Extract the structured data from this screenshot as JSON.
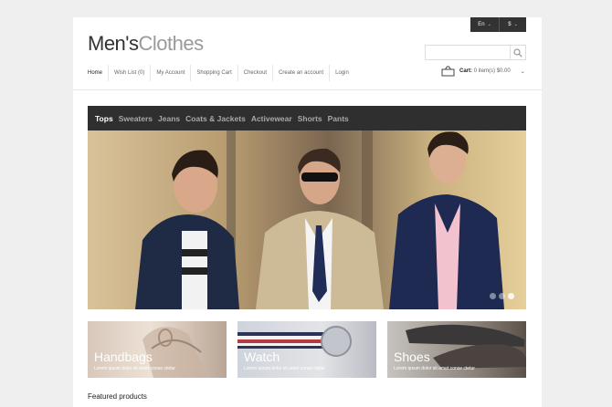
{
  "topbar": {
    "language": "En",
    "currency": "$"
  },
  "logo": {
    "part1": "Men's",
    "part2": "Clothes"
  },
  "search": {
    "placeholder": ""
  },
  "nav": [
    "Home",
    "Wish List (0)",
    "My Account",
    "Shopping Cart",
    "Checkout",
    "Create an account",
    "Login"
  ],
  "cart": {
    "label": "Cart:",
    "summary": "0 item(s) $0.00"
  },
  "categories": [
    "Tops",
    "Sweaters",
    "Jeans",
    "Coats & Jackets",
    "Activewear",
    "Shorts",
    "Pants"
  ],
  "slider": {
    "total_slides": 3,
    "active_slide": 3
  },
  "banners": [
    {
      "title": "Handbags",
      "text": "Lorem ipsum dolor sit amet conse ctetur"
    },
    {
      "title": "Watch",
      "text": "Lorem ipsum dolor sit amet conse ctetur"
    },
    {
      "title": "Shoes",
      "text": "Lorem ipsum dolor sit amet conse ctetur"
    }
  ],
  "featured": {
    "heading": "Featured products"
  },
  "colors": {
    "dark": "#2f2f2f",
    "background": "#efefef"
  }
}
